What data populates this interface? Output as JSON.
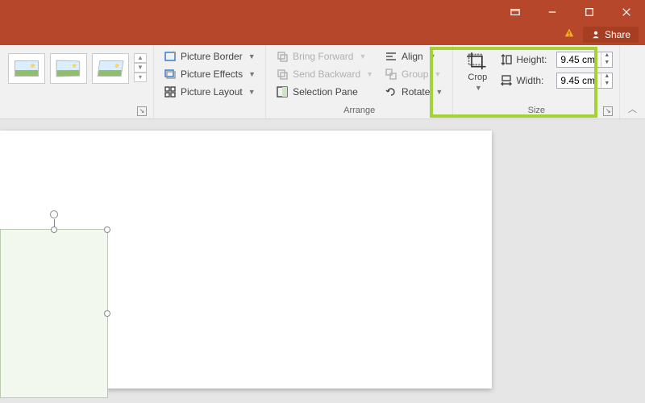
{
  "share_label": "Share",
  "picture_styles_group": "",
  "picture_border": "Picture Border",
  "picture_effects": "Picture Effects",
  "picture_layout": "Picture Layout",
  "arrange_group": "Arrange",
  "bring_forward": "Bring Forward",
  "send_backward": "Send Backward",
  "selection_pane": "Selection Pane",
  "align": "Align",
  "group": "Group",
  "rotate": "Rotate",
  "size_group": "Size",
  "crop": "Crop",
  "height_label": "Height:",
  "width_label": "Width:",
  "height_value": "9.45 cm",
  "width_value": "9.45 cm"
}
